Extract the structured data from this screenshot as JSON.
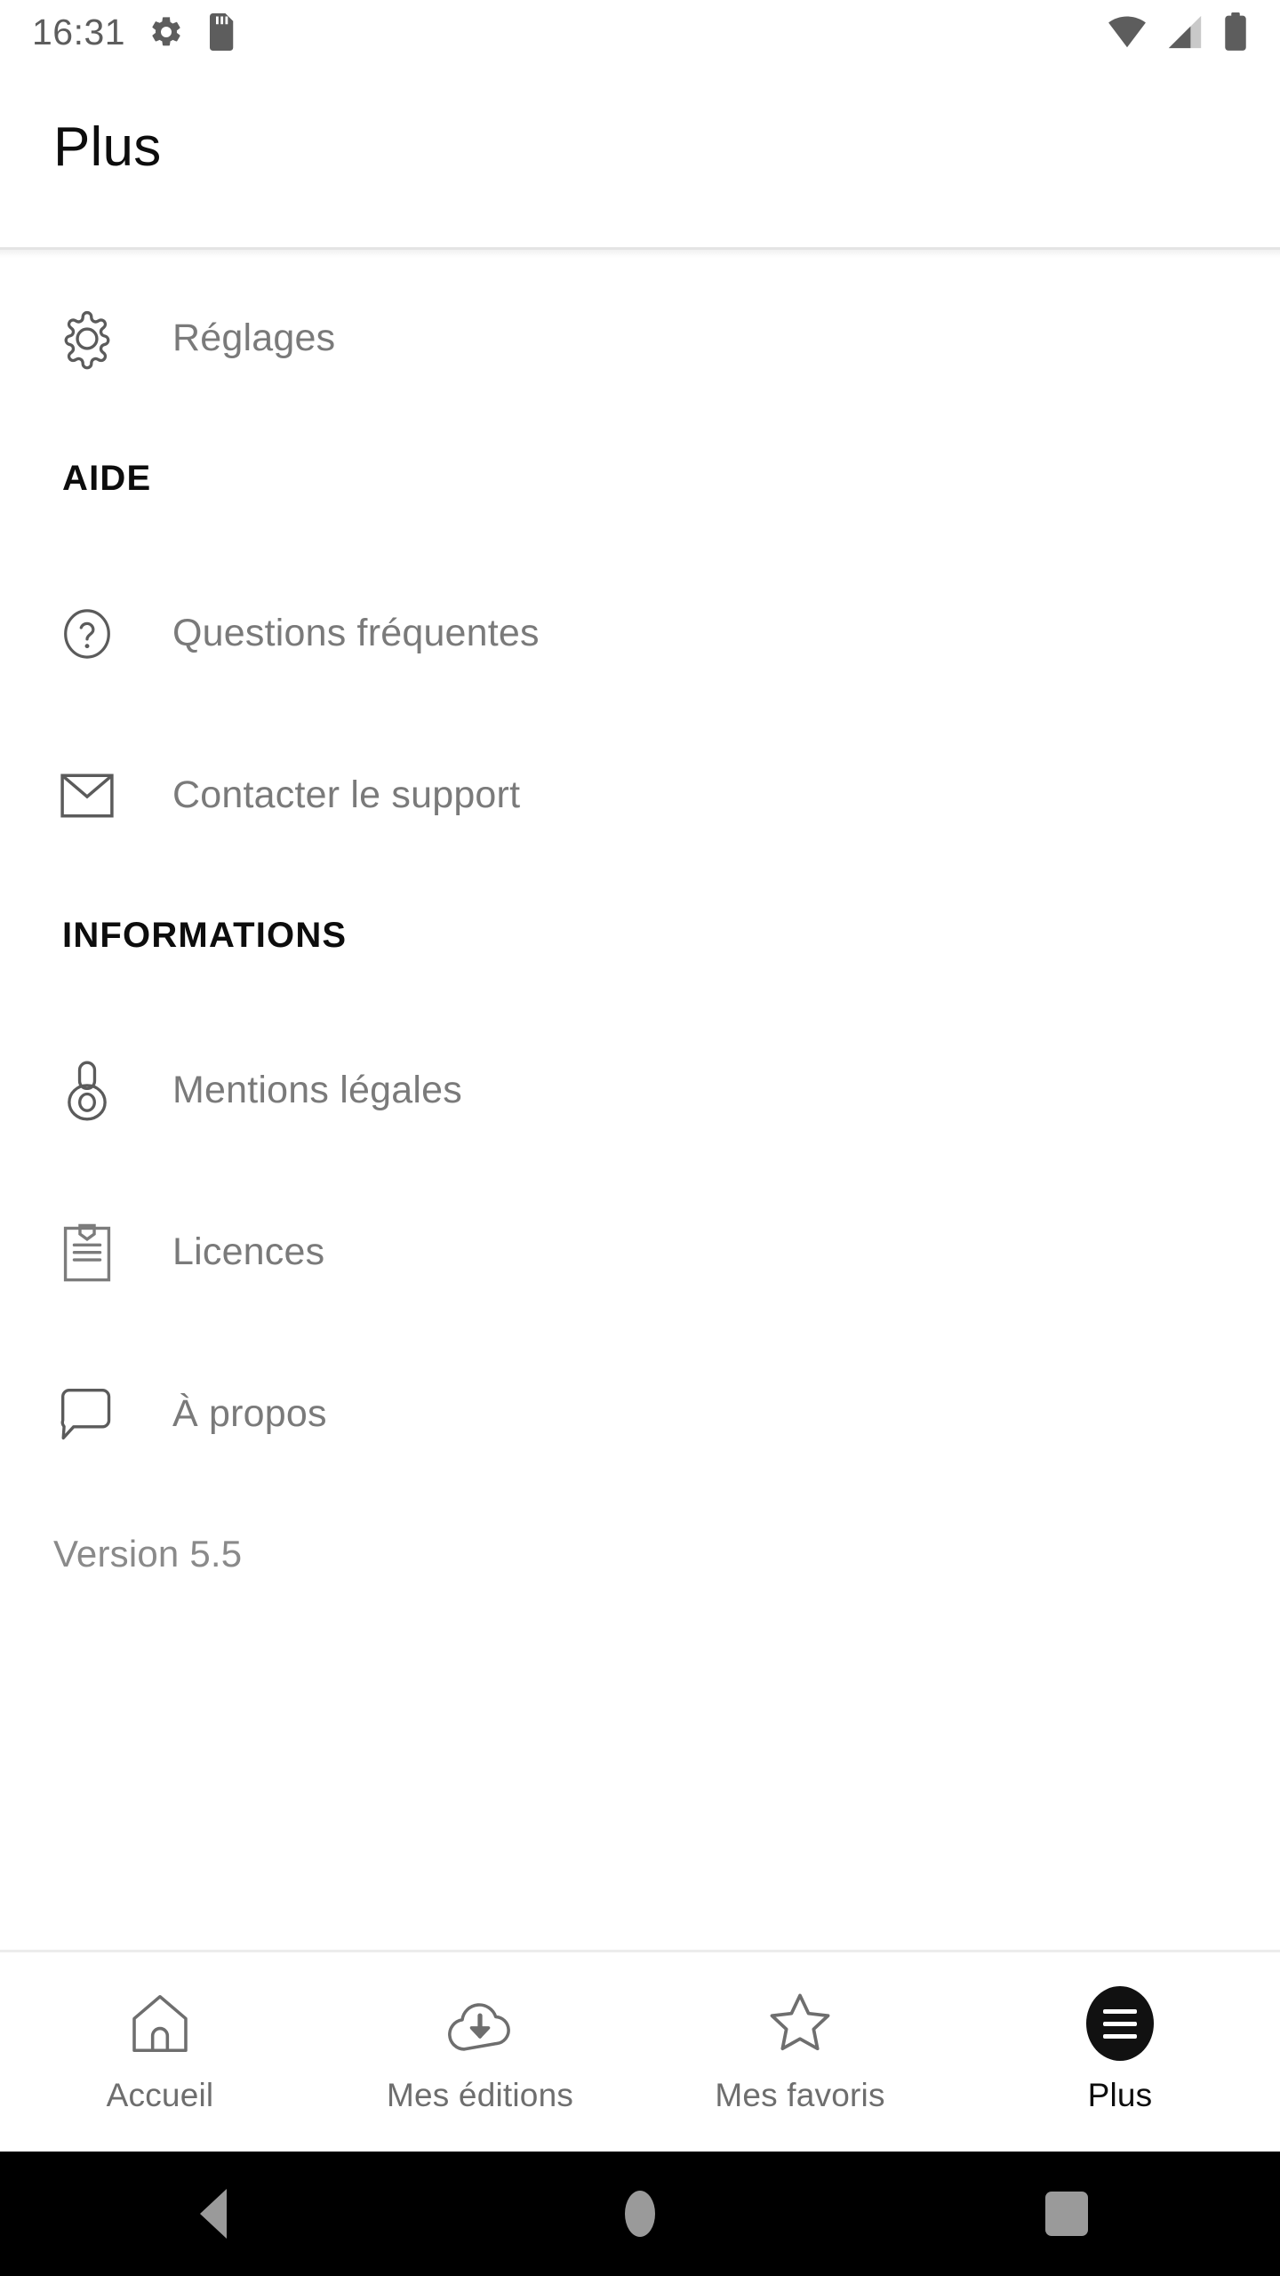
{
  "status_bar": {
    "time": "16:31",
    "left_icons": [
      "gear-icon",
      "sd-card-icon"
    ],
    "right_icons": [
      "wifi-icon",
      "signal-icon",
      "battery-icon"
    ]
  },
  "header": {
    "title": "Plus"
  },
  "main": {
    "top_items": [
      {
        "icon": "gear-icon",
        "label": "Réglages"
      }
    ],
    "sections": [
      {
        "heading": "AIDE",
        "items": [
          {
            "icon": "question-circle-icon",
            "label": "Questions fréquentes"
          },
          {
            "icon": "mail-icon",
            "label": "Contacter le support"
          }
        ]
      },
      {
        "heading": "INFORMATIONS",
        "items": [
          {
            "icon": "lock-icon",
            "label": "Mentions légales"
          },
          {
            "icon": "clipboard-icon",
            "label": "Licences"
          },
          {
            "icon": "speech-bubble-icon",
            "label": "À propos"
          }
        ]
      }
    ],
    "version": "Version 5.5"
  },
  "tab_bar": {
    "tabs": [
      {
        "icon": "home-icon",
        "label": "Accueil",
        "active": false
      },
      {
        "icon": "cloud-download-icon",
        "label": "Mes éditions",
        "active": false
      },
      {
        "icon": "star-icon",
        "label": "Mes favoris",
        "active": false
      },
      {
        "icon": "hamburger-menu-icon",
        "label": "Plus",
        "active": true
      }
    ]
  },
  "nav_bar": {
    "buttons": [
      "back-button",
      "home-button",
      "recents-button"
    ]
  },
  "colors": {
    "background": "#ffffff",
    "text_primary": "#0d0d0d",
    "text_secondary": "#7a7a7a",
    "divider": "#e4e4e4",
    "accent": "#111111",
    "nav_bar_background": "#000000"
  }
}
